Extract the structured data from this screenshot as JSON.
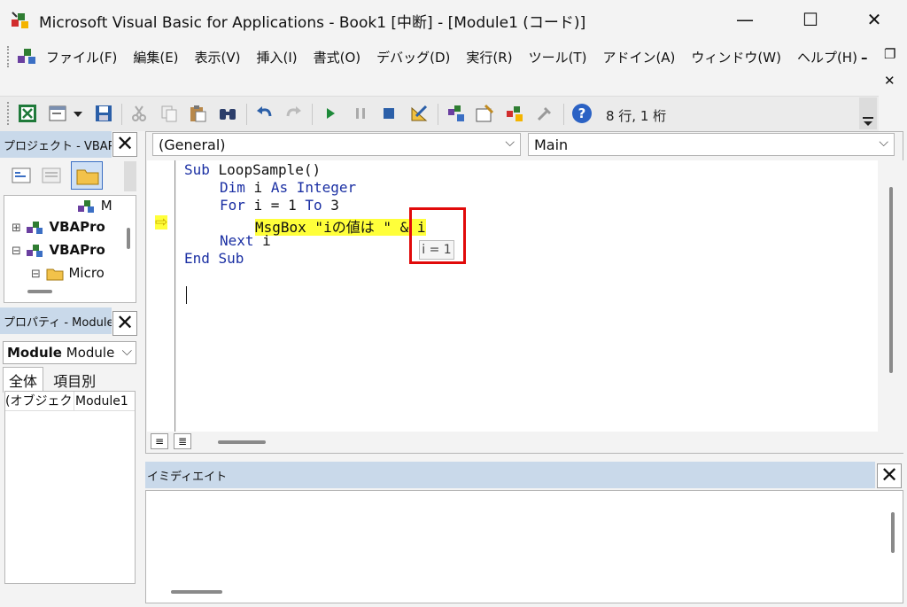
{
  "window": {
    "title": "Microsoft Visual Basic for Applications - Book1 [中断] - [Module1 (コード)]",
    "minimize": "—",
    "maximize": "☐",
    "close": "✕"
  },
  "menu": {
    "items": [
      "ファイル(F)",
      "編集(E)",
      "表示(V)",
      "挿入(I)",
      "書式(O)",
      "デバッグ(D)",
      "実行(R)",
      "ツール(T)",
      "アドイン(A)",
      "ウィンドウ(W)",
      "ヘルプ(H)"
    ],
    "mdi_minimize": "–",
    "mdi_restore": "❐",
    "mdi_close": "✕"
  },
  "toolbar": {
    "status": "8 行, 1 桁"
  },
  "project_panel": {
    "title": "プロジェクト - VBAP",
    "close": "✕",
    "tree": [
      "M",
      "VBAPro",
      "VBAPro",
      "Micro"
    ],
    "expanders": [
      "⊞",
      "⊟",
      "⊟"
    ]
  },
  "properties_panel": {
    "title": "プロパティ - Module",
    "close": "✕",
    "object_name": "Module",
    "object_type": "Module",
    "dropdown_arrow": "⌵",
    "tabs": [
      "全体",
      "項目別"
    ],
    "row_name": "(オブジェク",
    "row_value": "Module1"
  },
  "code_window": {
    "object_combo": "(General)",
    "proc_combo": "Main",
    "combo_arrow": "⌵",
    "exec_arrow": "⇨",
    "lines": {
      "l1_kw": "Sub",
      "l1_rest": " LoopSample()",
      "l2_kw1": "Dim",
      "l2_rest1": " i ",
      "l2_kw2": "As",
      "l2_rest2": " ",
      "l2_kw3": "Integer",
      "l3_kw1": "For",
      "l3_rest": " i = 1 ",
      "l3_kw2": "To",
      "l3_rest2": " 3",
      "l4_text": "MsgBox \"iの値は \" & i",
      "l5_kw": "Next",
      "l5_rest": " i",
      "l6_kw": "End Sub"
    },
    "tooltip": "i = 1",
    "view_proc": "≡",
    "view_module": "≣"
  },
  "immediate": {
    "title": "イミディエイト",
    "close": "✕"
  },
  "colors": {
    "panel_title_bg": "#c9d9ea",
    "highlight": "#ffff3a",
    "keyword": "#1a2fa3",
    "annotation": "#e10a0a"
  }
}
